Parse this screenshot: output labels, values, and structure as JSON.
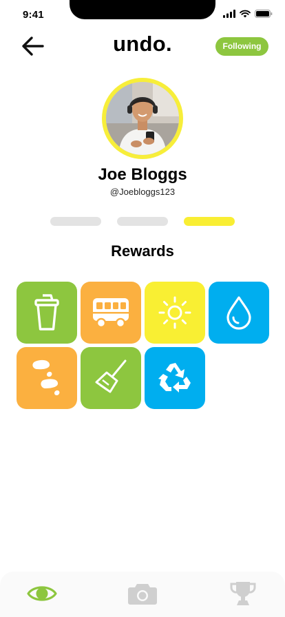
{
  "status_bar": {
    "time": "9:41"
  },
  "header": {
    "title": "undo.",
    "follow_label": "Following",
    "back_icon": "arrow-left-icon"
  },
  "profile": {
    "name": "Joe Bloggs",
    "handle": "@Joebloggs123",
    "avatar_ring_color": "#f7ee3a"
  },
  "page_indicators": {
    "count": 3,
    "active_index": 2,
    "active_color": "#f9ee33",
    "inactive_color": "#e3e3e3"
  },
  "rewards": {
    "title": "Rewards",
    "items": [
      {
        "icon": "reusable-cup-icon",
        "color": "#8dc63f"
      },
      {
        "icon": "bus-icon",
        "color": "#fbb040"
      },
      {
        "icon": "sun-icon",
        "color": "#f9ef33"
      },
      {
        "icon": "water-drop-icon",
        "color": "#00aeef"
      },
      {
        "icon": "footsteps-icon",
        "color": "#fbb040"
      },
      {
        "icon": "broom-icon",
        "color": "#8dc63f"
      },
      {
        "icon": "recycle-icon",
        "color": "#00aeef"
      }
    ]
  },
  "bottom_nav": {
    "items": [
      {
        "icon": "eye-icon",
        "active": true,
        "color": "#8dc63f"
      },
      {
        "icon": "camera-icon",
        "active": false,
        "color": "#cfcfcf"
      },
      {
        "icon": "trophy-icon",
        "active": false,
        "color": "#cfcfcf"
      }
    ]
  }
}
